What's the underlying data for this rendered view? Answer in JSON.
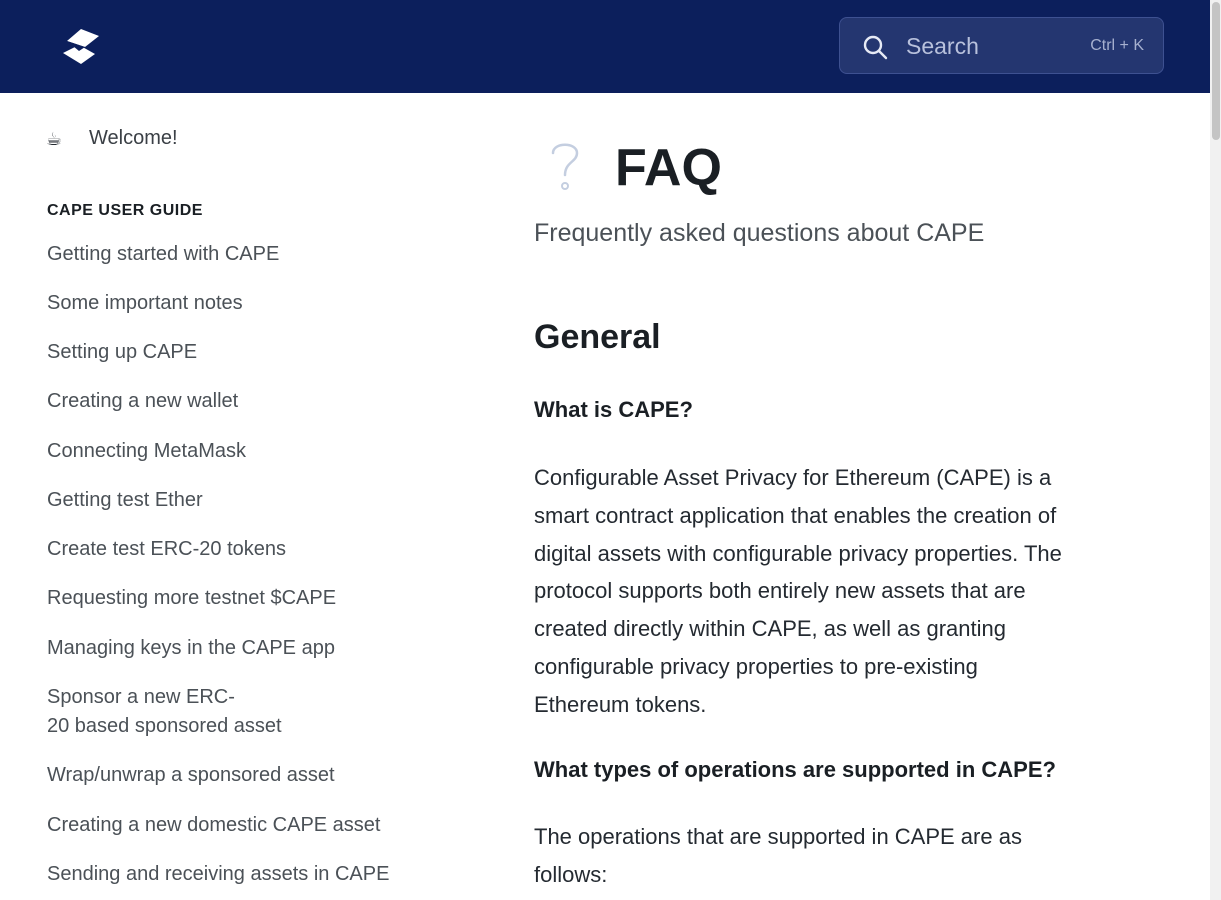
{
  "header": {
    "logo_icon": "snark-logo-icon",
    "search": {
      "label": "Search",
      "shortcut": "Ctrl + K",
      "icon": "search-icon"
    }
  },
  "sidebar": {
    "welcome": {
      "emoji": "☕",
      "label": "Welcome!"
    },
    "section_title": "CAPE USER GUIDE",
    "items": [
      {
        "label": "Getting started with CAPE"
      },
      {
        "label": "Some important notes"
      },
      {
        "label": "Setting up CAPE"
      },
      {
        "label": "Creating a new wallet"
      },
      {
        "label": "Connecting MetaMask"
      },
      {
        "label": "Getting test Ether"
      },
      {
        "label": "Create test ERC-20 tokens"
      },
      {
        "label": "Requesting more testnet $CAPE"
      },
      {
        "label": "Managing keys in the CAPE app"
      },
      {
        "label_line1": "Sponsor a new ERC-",
        "label_line2": "20 based sponsored asset"
      },
      {
        "label": "Wrap/unwrap a sponsored asset"
      },
      {
        "label": "Creating a new domestic CAPE asset"
      },
      {
        "label": "Sending and receiving assets in CAPE"
      }
    ]
  },
  "main": {
    "icon": "question-mark-icon",
    "title": "FAQ",
    "subtitle": "Frequently asked questions about CAPE",
    "section_heading": "General",
    "q1": "What is CAPE?",
    "a1_lines": [
      "Configurable Asset Privacy for Ethereum (CAPE) is a",
      "smart contract application that enables the creation of",
      "digital assets with configurable privacy properties. The",
      "protocol supports both entirely new assets that are",
      "created directly within CAPE, as well as granting",
      "configurable privacy properties to pre-existing",
      "Ethereum tokens."
    ],
    "q2": "What types of operations are supported in CAPE?",
    "a2_lines": [
      "The operations that are supported in CAPE are as",
      "follows:"
    ]
  },
  "colors": {
    "header_bg": "#0c1f5c",
    "search_bg": "#243670"
  }
}
